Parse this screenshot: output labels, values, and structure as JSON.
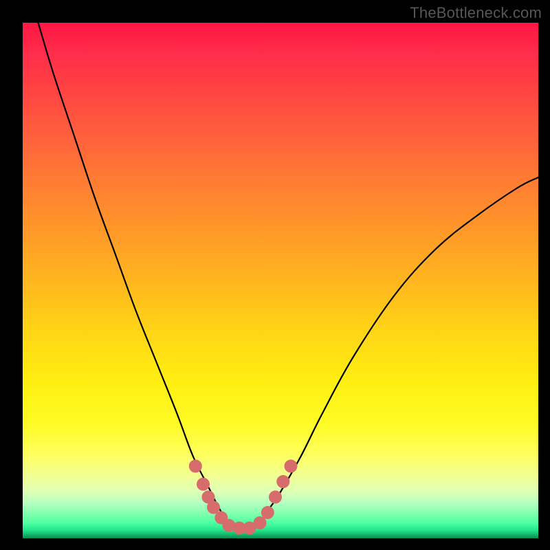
{
  "watermark": "TheBottleneck.com",
  "colors": {
    "frame": "#000000",
    "curve_stroke": "#000000",
    "marker_fill": "#d76c6c",
    "marker_stroke": "#d76c6c"
  },
  "chart_data": {
    "type": "line",
    "title": "",
    "xlabel": "",
    "ylabel": "",
    "xlim": [
      0,
      100
    ],
    "ylim": [
      0,
      100
    ],
    "grid": false,
    "legend": false,
    "background": "rainbow-vertical-gradient",
    "series": [
      {
        "name": "bottleneck-curve",
        "x": [
          3,
          6,
          10,
          14,
          18,
          22,
          26,
          30,
          33,
          36,
          38,
          40,
          42,
          44,
          46,
          48,
          50,
          54,
          58,
          64,
          72,
          80,
          88,
          96,
          100
        ],
        "y": [
          100,
          90,
          78,
          66,
          55,
          44,
          34,
          24,
          16,
          10,
          6,
          3,
          2,
          2,
          3,
          6,
          9,
          16,
          24,
          35,
          47,
          56,
          62.5,
          68,
          70
        ]
      }
    ],
    "markers": {
      "name": "highlight-dots",
      "points": [
        {
          "x": 33.5,
          "y": 14
        },
        {
          "x": 35,
          "y": 10.5
        },
        {
          "x": 36,
          "y": 8
        },
        {
          "x": 37,
          "y": 6
        },
        {
          "x": 38.5,
          "y": 4
        },
        {
          "x": 40,
          "y": 2.5
        },
        {
          "x": 42,
          "y": 2
        },
        {
          "x": 44,
          "y": 2
        },
        {
          "x": 46,
          "y": 3
        },
        {
          "x": 47.5,
          "y": 5
        },
        {
          "x": 49,
          "y": 8
        },
        {
          "x": 50.5,
          "y": 11
        },
        {
          "x": 52,
          "y": 14
        }
      ],
      "radius_px": 9
    }
  }
}
